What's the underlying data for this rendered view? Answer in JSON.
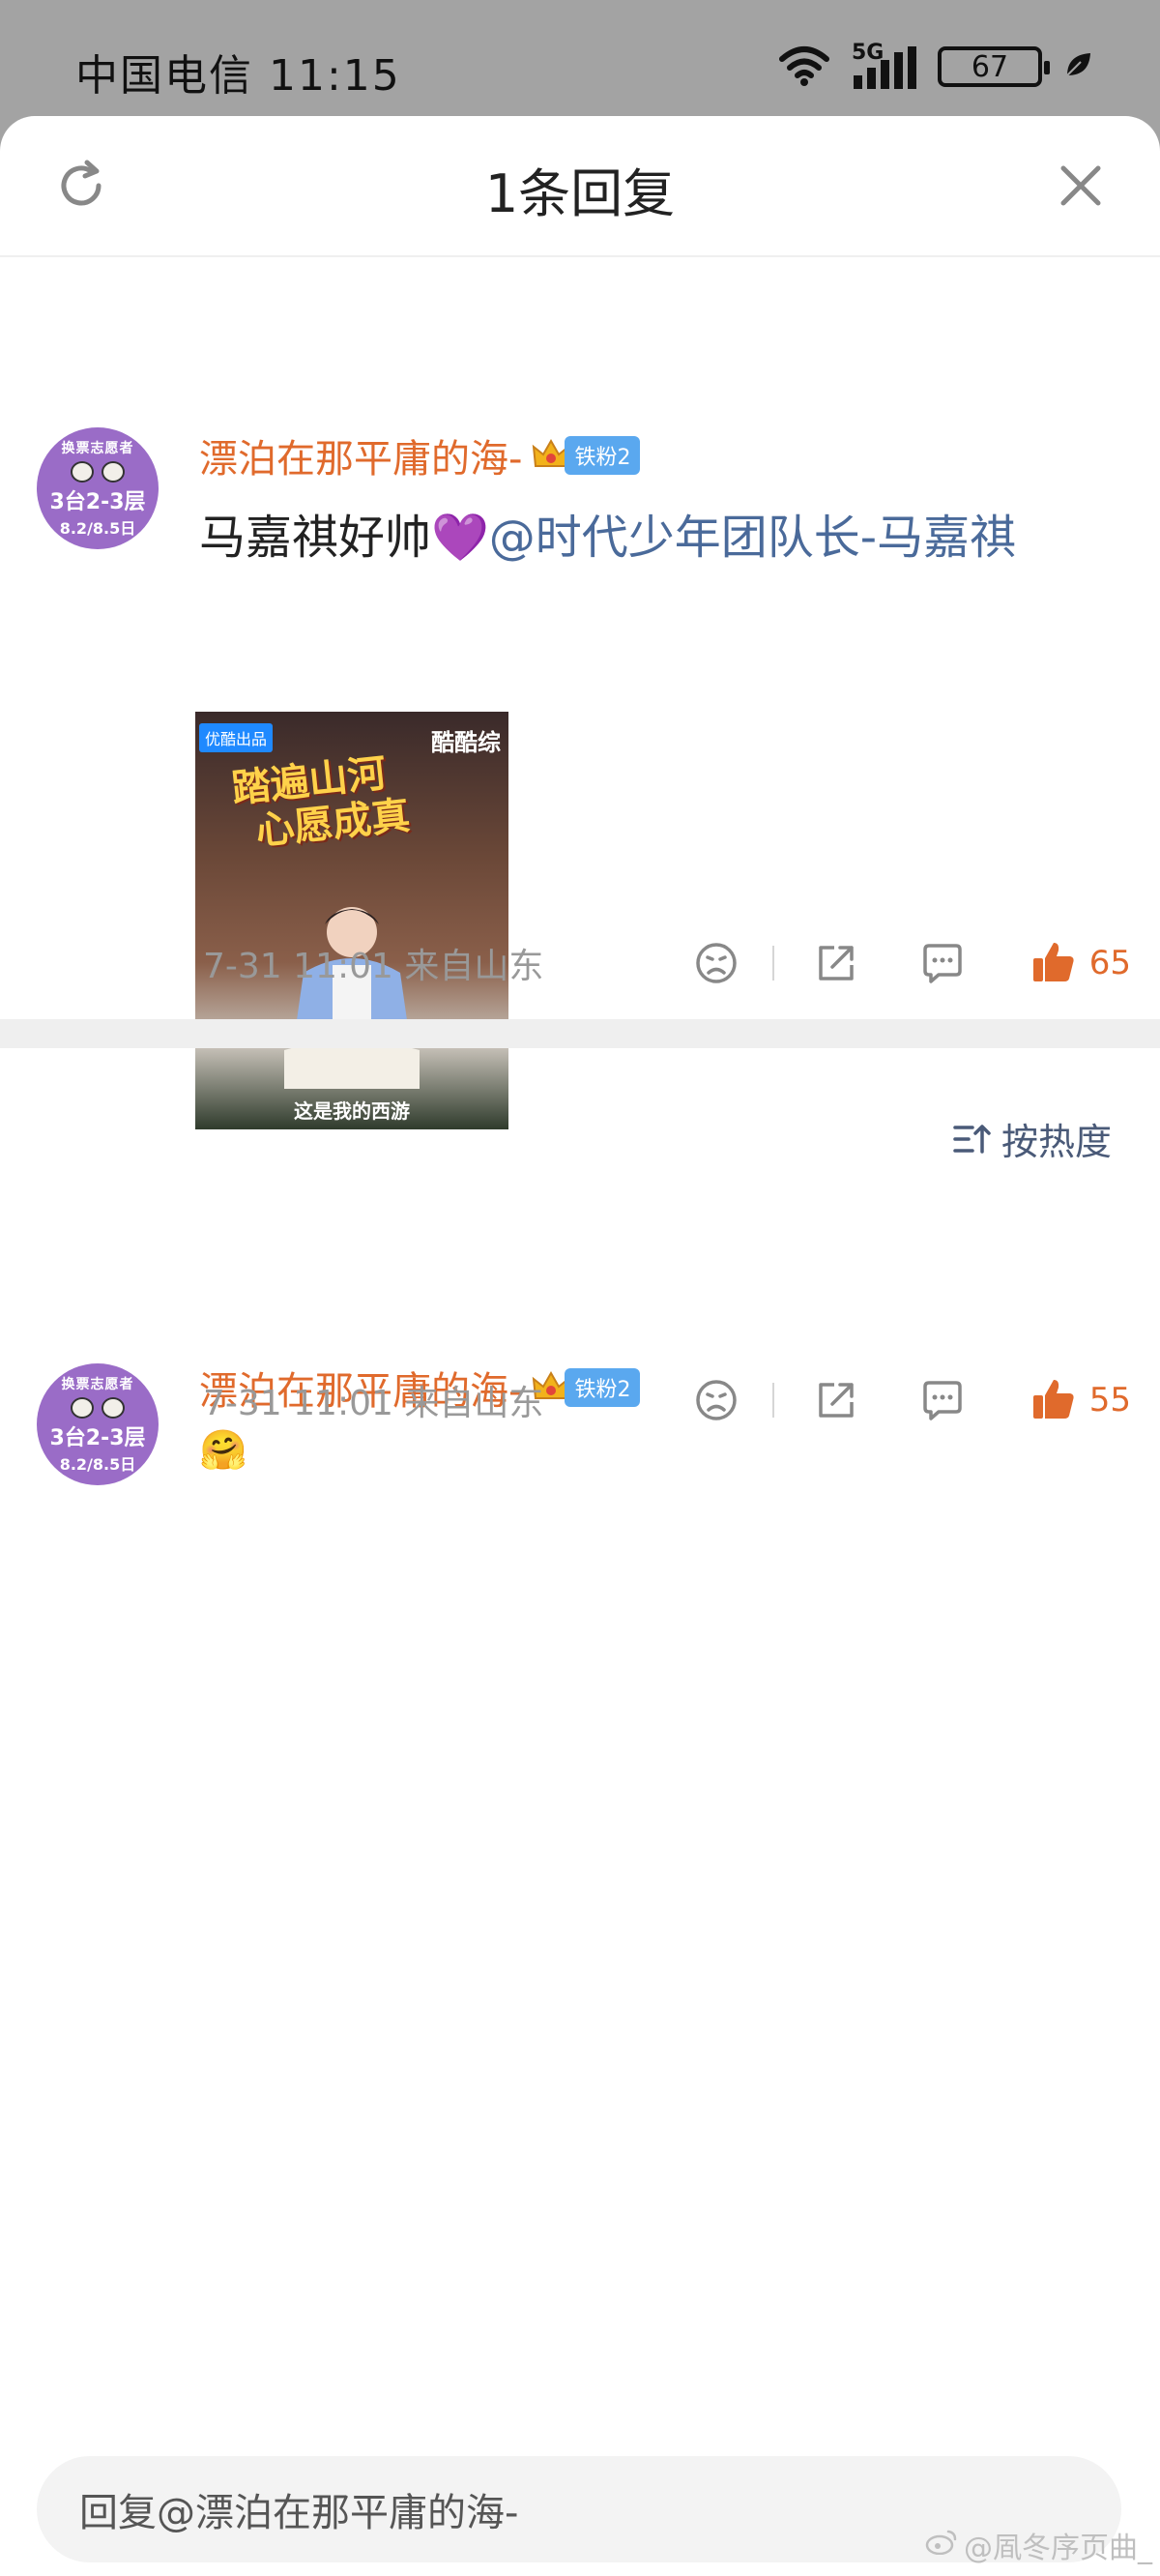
{
  "status_bar": {
    "carrier_time": "中国电信 11:15",
    "network": "5G",
    "battery": "67"
  },
  "header": {
    "title": "1条回复"
  },
  "main_comment": {
    "username": "漂泊在那平庸的海-",
    "fan_badge": "铁粉2",
    "avatar": {
      "line1": "换票志愿者",
      "line2": "3台2-3层",
      "line3": "8.2/8.5日"
    },
    "text_prefix": "马嘉祺好帅",
    "emoji": "💜",
    "mention": "@时代少年团队长-马嘉祺",
    "image": {
      "tag": "优酷出品",
      "logo": "酷酷综",
      "title_line1": "踏遍山河",
      "title_line2": "心愿成真",
      "caption": "这是我的西游"
    },
    "meta": "7-31 11:01 来自山东",
    "likes": "65"
  },
  "sort": {
    "label": "按热度"
  },
  "reply_comment": {
    "username": "漂泊在那平庸的海-",
    "fan_badge": "铁粉2",
    "avatar": {
      "line1": "换票志愿者",
      "line2": "3台2-3层",
      "line3": "8.2/8.5日"
    },
    "text": "🤗",
    "meta": "7-31 11:01 来自山东",
    "likes": "55"
  },
  "reply_bar": {
    "placeholder": "回复@漂泊在那平庸的海-"
  },
  "watermark": {
    "text": "@凮冬序页曲_"
  },
  "colors": {
    "username": "#e06a2c",
    "mention": "#4a6a9a",
    "like": "#e06a2c",
    "badge": "#5aa8ef",
    "avatar": "#9a6cc7"
  }
}
